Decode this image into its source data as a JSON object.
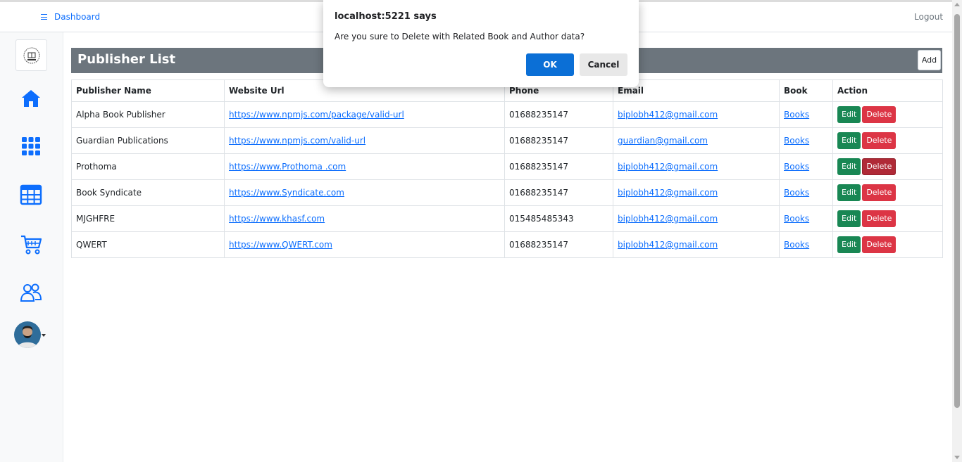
{
  "navbar": {
    "dashboard_label": "Dashboard",
    "logout_label": "Logout"
  },
  "sidebar": {
    "icons": [
      "home-icon",
      "apps-grid-icon",
      "table-icon",
      "cart-icon",
      "users-icon"
    ],
    "accent_color": "#0d6efd"
  },
  "page": {
    "title": "Publisher List",
    "add_label": "Add"
  },
  "table": {
    "headers": [
      "Publisher Name",
      "Website Url",
      "Phone",
      "Email",
      "Book",
      "Action"
    ],
    "rows": [
      {
        "name": "Alpha Book Publisher",
        "url": "https://www.npmjs.com/package/valid-url",
        "phone": "01688235147",
        "email": "biplobh412@gmail.com",
        "book": "Books",
        "edit": "Edit",
        "delete": "Delete"
      },
      {
        "name": "Guardian Publications",
        "url": "https://www.npmjs.com/valid-url",
        "phone": "01688235147",
        "email": "guardian@gmail.com",
        "book": "Books",
        "edit": "Edit",
        "delete": "Delete"
      },
      {
        "name": "Prothoma",
        "url": "https://www.Prothoma .com",
        "phone": "01688235147",
        "email": "biplobh412@gmail.com",
        "book": "Books",
        "edit": "Edit",
        "delete": "Delete"
      },
      {
        "name": "Book Syndicate",
        "url": "https://www.Syndicate.com",
        "phone": "01688235147",
        "email": "biplobh412@gmail.com",
        "book": "Books",
        "edit": "Edit",
        "delete": "Delete"
      },
      {
        "name": "MJGHFRE",
        "url": "https://www.khasf.com",
        "phone": "015485485343",
        "email": "biplobh412@gmail.com",
        "book": "Books",
        "edit": "Edit",
        "delete": "Delete"
      },
      {
        "name": "QWERT",
        "url": "https://www.QWERT.com",
        "phone": "01688235147",
        "email": "biplobh412@gmail.com",
        "book": "Books",
        "edit": "Edit",
        "delete": "Delete"
      }
    ]
  },
  "dialog": {
    "title": "localhost:5221 says",
    "message": "Are you sure to Delete with Related Book and Author data?",
    "ok_label": "OK",
    "cancel_label": "Cancel"
  },
  "colors": {
    "header_bg": "#6c757d",
    "edit_bg": "#198754",
    "delete_bg": "#dc3545",
    "link": "#0d6efd",
    "dialog_ok": "#0b6fd6"
  }
}
